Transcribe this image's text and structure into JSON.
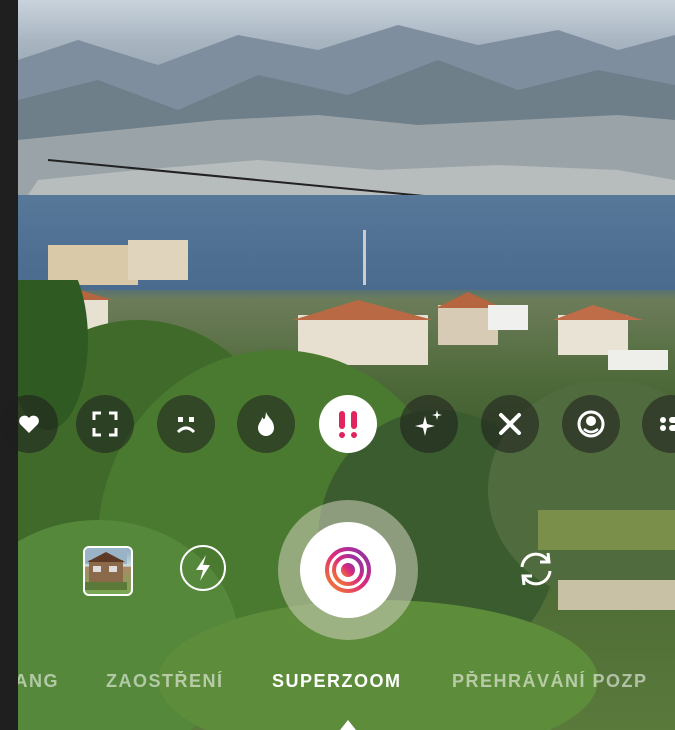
{
  "camera": {
    "effects": [
      {
        "icon": "heart-icon"
      },
      {
        "icon": "focus-frame-icon"
      },
      {
        "icon": "sad-face-icon"
      },
      {
        "icon": "fire-icon"
      },
      {
        "icon": "double-exclamation-icon",
        "selected": true
      },
      {
        "icon": "sparkles-icon"
      },
      {
        "icon": "close-x-icon"
      },
      {
        "icon": "face-effect-icon"
      },
      {
        "icon": "more-effects-icon"
      }
    ],
    "controls": {
      "gallery": "gallery-thumbnail",
      "flash": "flash-icon",
      "shutter": "shutter-button",
      "flip": "flip-camera-icon"
    },
    "modes": [
      "RANG",
      "ZAOSTŘENÍ",
      "SUPERZOOM",
      "PŘEHRÁVÁNÍ POZP"
    ],
    "active_mode": "SUPERZOOM",
    "colors": {
      "accent_gradient_start": "#f58529",
      "accent_gradient_end": "#8134af",
      "active_effect_icon": "#e0245e"
    }
  }
}
